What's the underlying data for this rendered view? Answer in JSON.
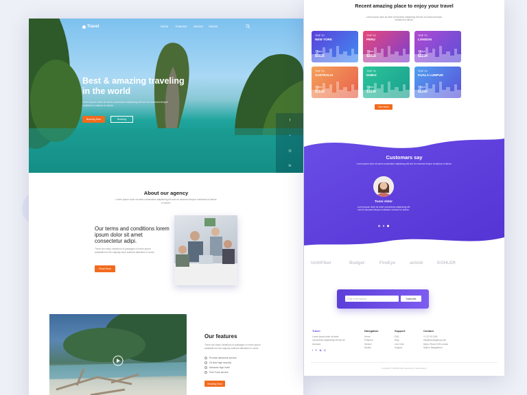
{
  "nav": {
    "logo": "Travel",
    "links": [
      "Home",
      "Features",
      "Service",
      "Stories"
    ]
  },
  "hero": {
    "title": "Best & amazing traveling in the world",
    "description": "Lorem ipsum dolor sit amet consectetur adipisicing elit sed do eiusmod tempor incididunt ut labore et dolore.",
    "book_button": "Booking Now",
    "second_button": "Booking"
  },
  "about": {
    "title": "About our agency",
    "description": "Lorem ipsum dolor sit amet consectetur adipisicing elit sed do eiusmod tempor incididunt ut labore et dolore.",
    "terms_title": "Our terms and conditions lorem ipsum dolor sit amet consectetur adipi.",
    "terms_description": "There are many variations of passages of lorem ipsum available but the majority have suffered alteration in some.",
    "read_more": "Read More"
  },
  "features": {
    "title": "Our features",
    "description": "There are many variations of passages of lorem ipsum available but the majority suffered alteration in some.",
    "items": [
      "Provide awesome service",
      "24 time high security",
      "Advance high hotel",
      "Feel Fune service"
    ],
    "button": "Booking Now"
  },
  "trips": {
    "title": "Recent amazing place to enjoy your travel",
    "description": "Lorem ipsum dolor sit amet consectetur adipisicing elit sed do eiusmod tempor incididunt ut labore.",
    "cards": [
      {
        "label": "TRIP TO",
        "city": "NEW YORK",
        "days": "7 Days",
        "price": "$3025",
        "color": "#5b3fd9",
        "color2": "#3f8ef2"
      },
      {
        "label": "TRIP TO",
        "city": "PERU",
        "days": "7 Days",
        "price": "$2015",
        "color": "#e8487a",
        "color2": "#7a3fd0"
      },
      {
        "label": "TRIP TO",
        "city": "LONDON",
        "days": "7 Days",
        "price": "$2234",
        "color": "#b04ad0",
        "color2": "#5b4fd9"
      },
      {
        "label": "TRIP TO",
        "city": "AUSTRALIA",
        "days": "7 Days",
        "price": "$1520",
        "color": "#f4a25a",
        "color2": "#e8604c"
      },
      {
        "label": "TRIP TO",
        "city": "DUBAI",
        "days": "7 Days",
        "price": "$1506",
        "color": "#2bc49a",
        "color2": "#1a9f8f"
      },
      {
        "label": "TRIP TO",
        "city": "KUALA LUMPUR",
        "days": "7 Days",
        "price": "$1260",
        "color": "#4fa0f0",
        "color2": "#5b4fd9"
      }
    ],
    "see_more": "See More"
  },
  "customers": {
    "title": "Customars say",
    "description": "Lorem ipsum dolor sit amet consectetur adipisicing elit sed do eiusmod tempor incididunt ut labore.",
    "name": "Tunni Akter",
    "quote": "Lorem ipsum dolor sit amet consectetur adipisicing elit sed do eiusmod tempor incididunt ut labore et dolore."
  },
  "partners": [
    "UnitiFiber",
    "Budget",
    "FireEye",
    "airbnb",
    "KOHLER"
  ],
  "newsletter": {
    "placeholder": "Enter email address",
    "button": "Subscribe"
  },
  "footer": {
    "brand": "Travel",
    "brand_desc": "Lorem ipsum dolor sit amet consectetur adipisicing elit sed do eiusmod.",
    "navigation_head": "Navigation",
    "navigation": [
      "Home",
      "Features",
      "Service",
      "Stories"
    ],
    "support_head": "Support",
    "support": [
      "FAQ",
      "Blog",
      "Live Chat",
      "Support"
    ],
    "contact_head": "Contact",
    "contact": [
      "+1 22 92 2160",
      "info@travelagency.com",
      "Mirpur Road 10/5 London",
      "Sylhet, Bangladesh"
    ],
    "copyright": "Copyright © 2018 All right reserved by Travel Agency"
  },
  "colors": {
    "accent": "#f26b1d",
    "purple": "#6a4ce6",
    "teal": "#1fa59d"
  }
}
